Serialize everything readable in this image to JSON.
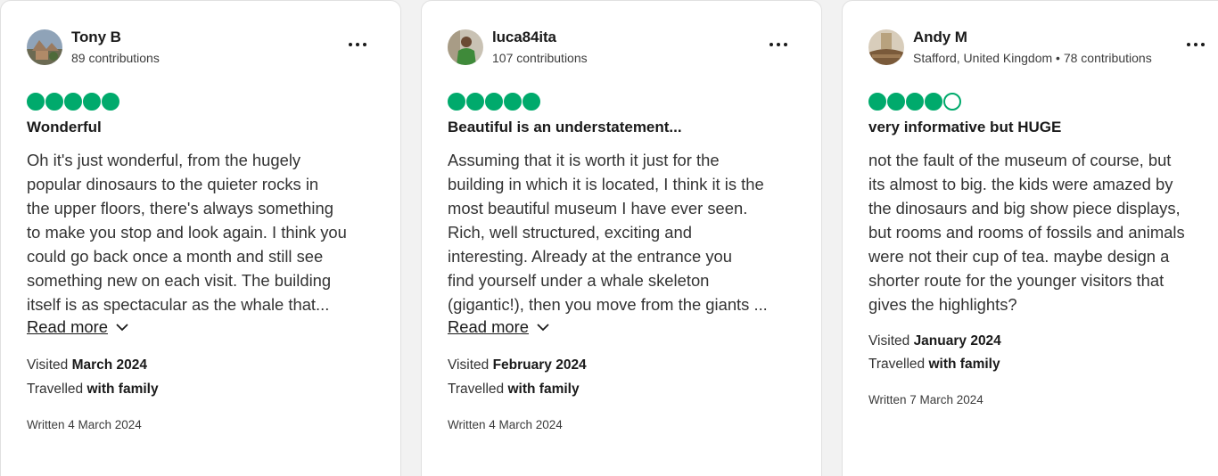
{
  "colors": {
    "rating_green": "#00aa6c",
    "card_bg": "#ffffff",
    "page_bg": "#f2f2f2"
  },
  "reviews": [
    {
      "name": "Tony B",
      "meta": "89 contributions",
      "rating": 5,
      "title": "Wonderful",
      "body_lines": [
        "Oh it's just wonderful, from the hugely",
        "popular dinosaurs to the quieter rocks in",
        "the upper floors, there's always something",
        "to make you stop and look again. I think you",
        "could go back once a month and still see",
        "something new on each visit. The building",
        "itself is as spectacular as the whale that..."
      ],
      "read_more": "Read more",
      "visited_label": "Visited",
      "visited_value": "March 2024",
      "travelled_label": "Travelled",
      "travelled_value": "with family",
      "written": "Written 4 March 2024"
    },
    {
      "name": "luca84ita",
      "meta": "107 contributions",
      "rating": 5,
      "title": "Beautiful is an understatement...",
      "body_lines": [
        "Assuming that it is worth it just for the",
        "building in which it is located, I think it is the",
        "most beautiful museum I have ever seen.",
        "Rich, well structured, exciting and",
        "interesting. Already at the entrance you",
        "find yourself under a whale skeleton",
        "(gigantic!), then you move from the giants ..."
      ],
      "read_more": "Read more",
      "visited_label": "Visited",
      "visited_value": "February 2024",
      "travelled_label": "Travelled",
      "travelled_value": "with family",
      "written": "Written 4 March 2024"
    },
    {
      "name": "Andy M",
      "meta": "Stafford, United Kingdom • 78 contributions",
      "rating": 4,
      "title": "very informative but HUGE",
      "body_lines": [
        "not the fault of the museum of course, but",
        "its almost to big. the kids were amazed by",
        "the dinosaurs and big show piece displays,",
        "but rooms and rooms of fossils and animals",
        "were not their cup of tea. maybe design a",
        "shorter route for the younger visitors that",
        "gives the highlights?"
      ],
      "visited_label": "Visited",
      "visited_value": "January 2024",
      "travelled_label": "Travelled",
      "travelled_value": "with family",
      "written": "Written 7 March 2024"
    }
  ]
}
